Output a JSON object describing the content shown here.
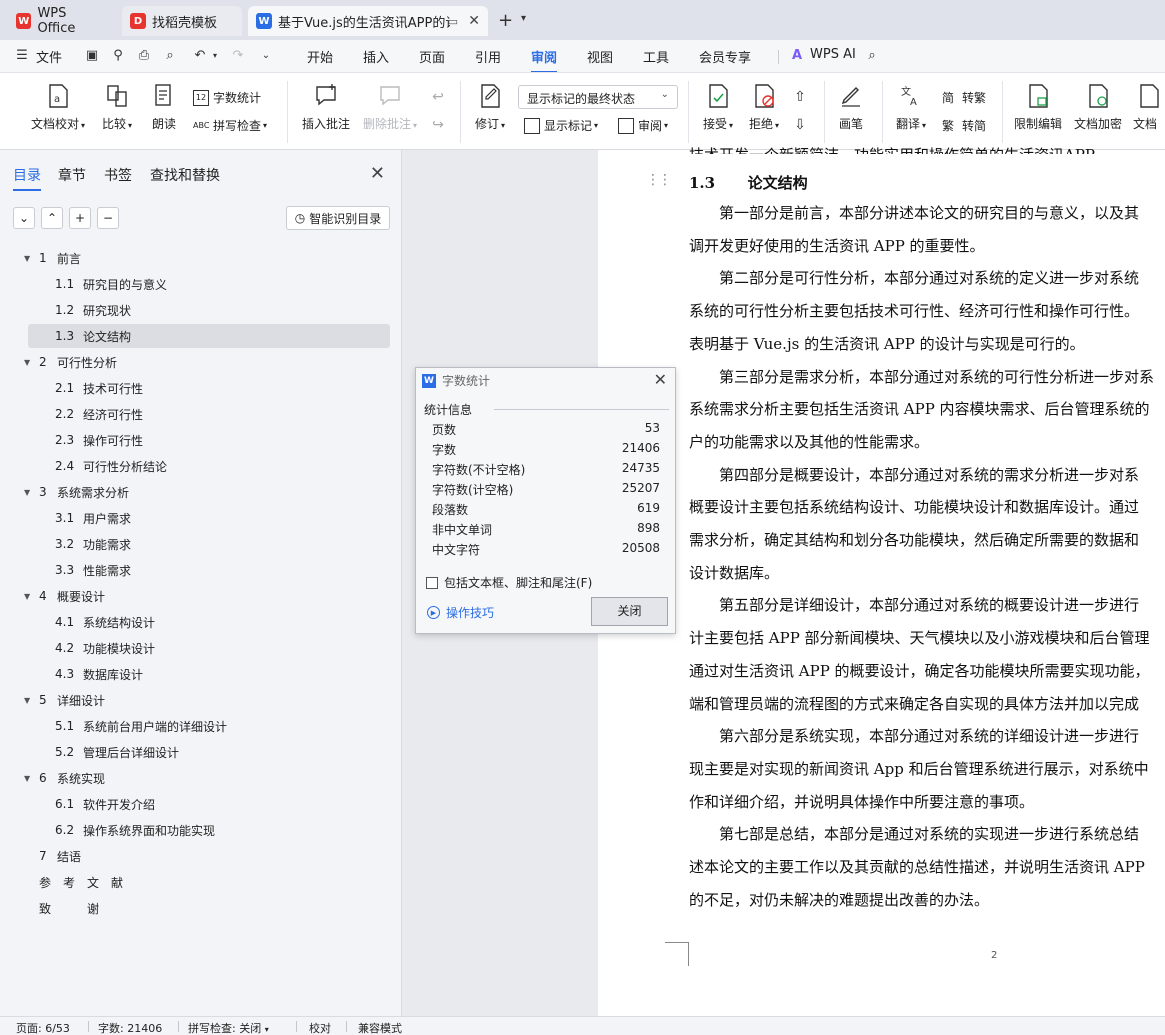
{
  "tabs": [
    {
      "label": "WPS Office",
      "icon": "wps-logo-icon",
      "color": "#e8342f"
    },
    {
      "label": "找稻壳模板",
      "icon": "docer-logo-icon",
      "color": "#e8342f"
    },
    {
      "label": "基于Vue.js的生活资讯APP的设",
      "icon": "word-doc-icon",
      "color": "#2b6de5"
    }
  ],
  "menubar": {
    "file": "文件",
    "items": [
      "开始",
      "插入",
      "页面",
      "引用",
      "审阅",
      "视图",
      "工具",
      "会员专享"
    ],
    "active": "审阅",
    "ai": "WPS AI"
  },
  "ribbon": {
    "proofread": "文档校对",
    "compare": "比较",
    "read_aloud": "朗读",
    "word_count": "字数统计",
    "spell_check": "拼写检查",
    "insert_comment": "插入批注",
    "delete_comment": "删除批注",
    "revise": "修订",
    "markup_select": "显示标记的最终状态",
    "show_markup": "显示标记",
    "review": "审阅",
    "accept": "接受",
    "reject": "拒绝",
    "pen": "画笔",
    "translate": "翻译",
    "to_traditional": "转繁",
    "to_simplified": "转简",
    "trad_glyph": "简",
    "simp_glyph": "繁",
    "restrict_edit": "限制编辑",
    "encrypt": "文档加密",
    "doc_cut": "文档"
  },
  "nav": {
    "tabs": [
      "目录",
      "章节",
      "书签",
      "查找和替换"
    ],
    "active_tab": "目录",
    "smart_btn": "智能识别目录",
    "toc": [
      {
        "num": "1",
        "title": "前言",
        "level": 1,
        "expanded": true
      },
      {
        "num": "1.1",
        "title": "研究目的与意义",
        "level": 2
      },
      {
        "num": "1.2",
        "title": "研究现状",
        "level": 2
      },
      {
        "num": "1.3",
        "title": "论文结构",
        "level": 2,
        "selected": true
      },
      {
        "num": "2",
        "title": "可行性分析",
        "level": 1,
        "expanded": true
      },
      {
        "num": "2.1",
        "title": "技术可行性",
        "level": 2
      },
      {
        "num": "2.2",
        "title": "经济可行性",
        "level": 2
      },
      {
        "num": "2.3",
        "title": "操作可行性",
        "level": 2
      },
      {
        "num": "2.4",
        "title": "可行性分析结论",
        "level": 2
      },
      {
        "num": "3",
        "title": "系统需求分析",
        "level": 1,
        "expanded": true
      },
      {
        "num": "3.1",
        "title": "用户需求",
        "level": 2
      },
      {
        "num": "3.2",
        "title": "功能需求",
        "level": 2
      },
      {
        "num": "3.3",
        "title": "性能需求",
        "level": 2
      },
      {
        "num": "4",
        "title": "概要设计",
        "level": 1,
        "expanded": true
      },
      {
        "num": "4.1",
        "title": "系统结构设计",
        "level": 2
      },
      {
        "num": "4.2",
        "title": "功能模块设计",
        "level": 2
      },
      {
        "num": "4.3",
        "title": "数据库设计",
        "level": 2
      },
      {
        "num": "5",
        "title": "详细设计",
        "level": 1,
        "expanded": true
      },
      {
        "num": "5.1",
        "title": "系统前台用户端的详细设计",
        "level": 2
      },
      {
        "num": "5.2",
        "title": "管理后台详细设计",
        "level": 2
      },
      {
        "num": "6",
        "title": "系统实现",
        "level": 1,
        "expanded": true
      },
      {
        "num": "6.1",
        "title": "软件开发介绍",
        "level": 2
      },
      {
        "num": "6.2",
        "title": "操作系统界面和功能实现",
        "level": 2
      },
      {
        "num": "7",
        "title": "结语",
        "level": 1
      },
      {
        "num": "",
        "title": "参　考　文　献",
        "level": 1
      },
      {
        "num": "",
        "title": "致　　　谢",
        "level": 1
      }
    ]
  },
  "document": {
    "cut_line": "技术开发一个新颖简洁、功能实用和操作简单的生活资讯APP",
    "heading_num": "1.3",
    "heading_title": "论文结构",
    "lines": [
      "　　第一部分是前言，本部分讲述本论文的研究目的与意义，以及其",
      "调开发更好使用的生活资讯 APP 的重要性。",
      "　　第二部分是可行性分析，本部分通过对系统的定义进一步对系统",
      "系统的可行性分析主要包括技术可行性、经济可行性和操作可行性。",
      "表明基于 Vue.js 的生活资讯 APP 的设计与实现是可行的。",
      "　　第三部分是需求分析，本部分通过对系统的可行性分析进一步对系",
      "系统需求分析主要包括生活资讯 APP 内容模块需求、后台管理系统的",
      "户的功能需求以及其他的性能需求。",
      "　　第四部分是概要设计，本部分通过对系统的需求分析进一步对系",
      "概要设计主要包括系统结构设计、功能模块设计和数据库设计。通过",
      "需求分析，确定其结构和划分各功能模块，然后确定所需要的数据和",
      "设计数据库。",
      "　　第五部分是详细设计，本部分通过对系统的概要设计进一步进行",
      "计主要包括 APP 部分新闻模块、天气模块以及小游戏模块和后台管理",
      "通过对生活资讯 APP 的概要设计，确定各功能模块所需要实现功能，",
      "端和管理员端的流程图的方式来确定各自实现的具体方法并加以完成",
      "　　第六部分是系统实现，本部分通过对系统的详细设计进一步进行",
      "现主要是对实现的新闻资讯 App 和后台管理系统进行展示，对系统中",
      "作和详细介绍，并说明具体操作中所要注意的事项。",
      "　　第七部是总结，本部分是通过对系统的实现进一步进行系统总结",
      "述本论文的主要工作以及其贡献的总结性描述，并说明生活资讯 APP",
      "的不足，对仍未解决的难题提出改善的办法。"
    ],
    "page_number": "2"
  },
  "dialog": {
    "title": "字数统计",
    "group": "统计信息",
    "stats": [
      {
        "label": "页数",
        "value": "53"
      },
      {
        "label": "字数",
        "value": "21406"
      },
      {
        "label": "字符数(不计空格)",
        "value": "24735"
      },
      {
        "label": "字符数(计空格)",
        "value": "25207"
      },
      {
        "label": "段落数",
        "value": "619"
      },
      {
        "label": "非中文单词",
        "value": "898"
      },
      {
        "label": "中文字符",
        "value": "20508"
      }
    ],
    "checkbox_label": "包括文本框、脚注和尾注(F)",
    "checkbox_checked": false,
    "tips": "操作技巧",
    "close": "关闭"
  },
  "statusbar": {
    "page": "页面: 6/53",
    "words": "字数: 21406",
    "spell": "拼写检查: 关闭",
    "proof": "校对",
    "compat": "兼容模式"
  },
  "colors": {
    "accent": "#2b6de5",
    "wps_red": "#e8342f"
  }
}
